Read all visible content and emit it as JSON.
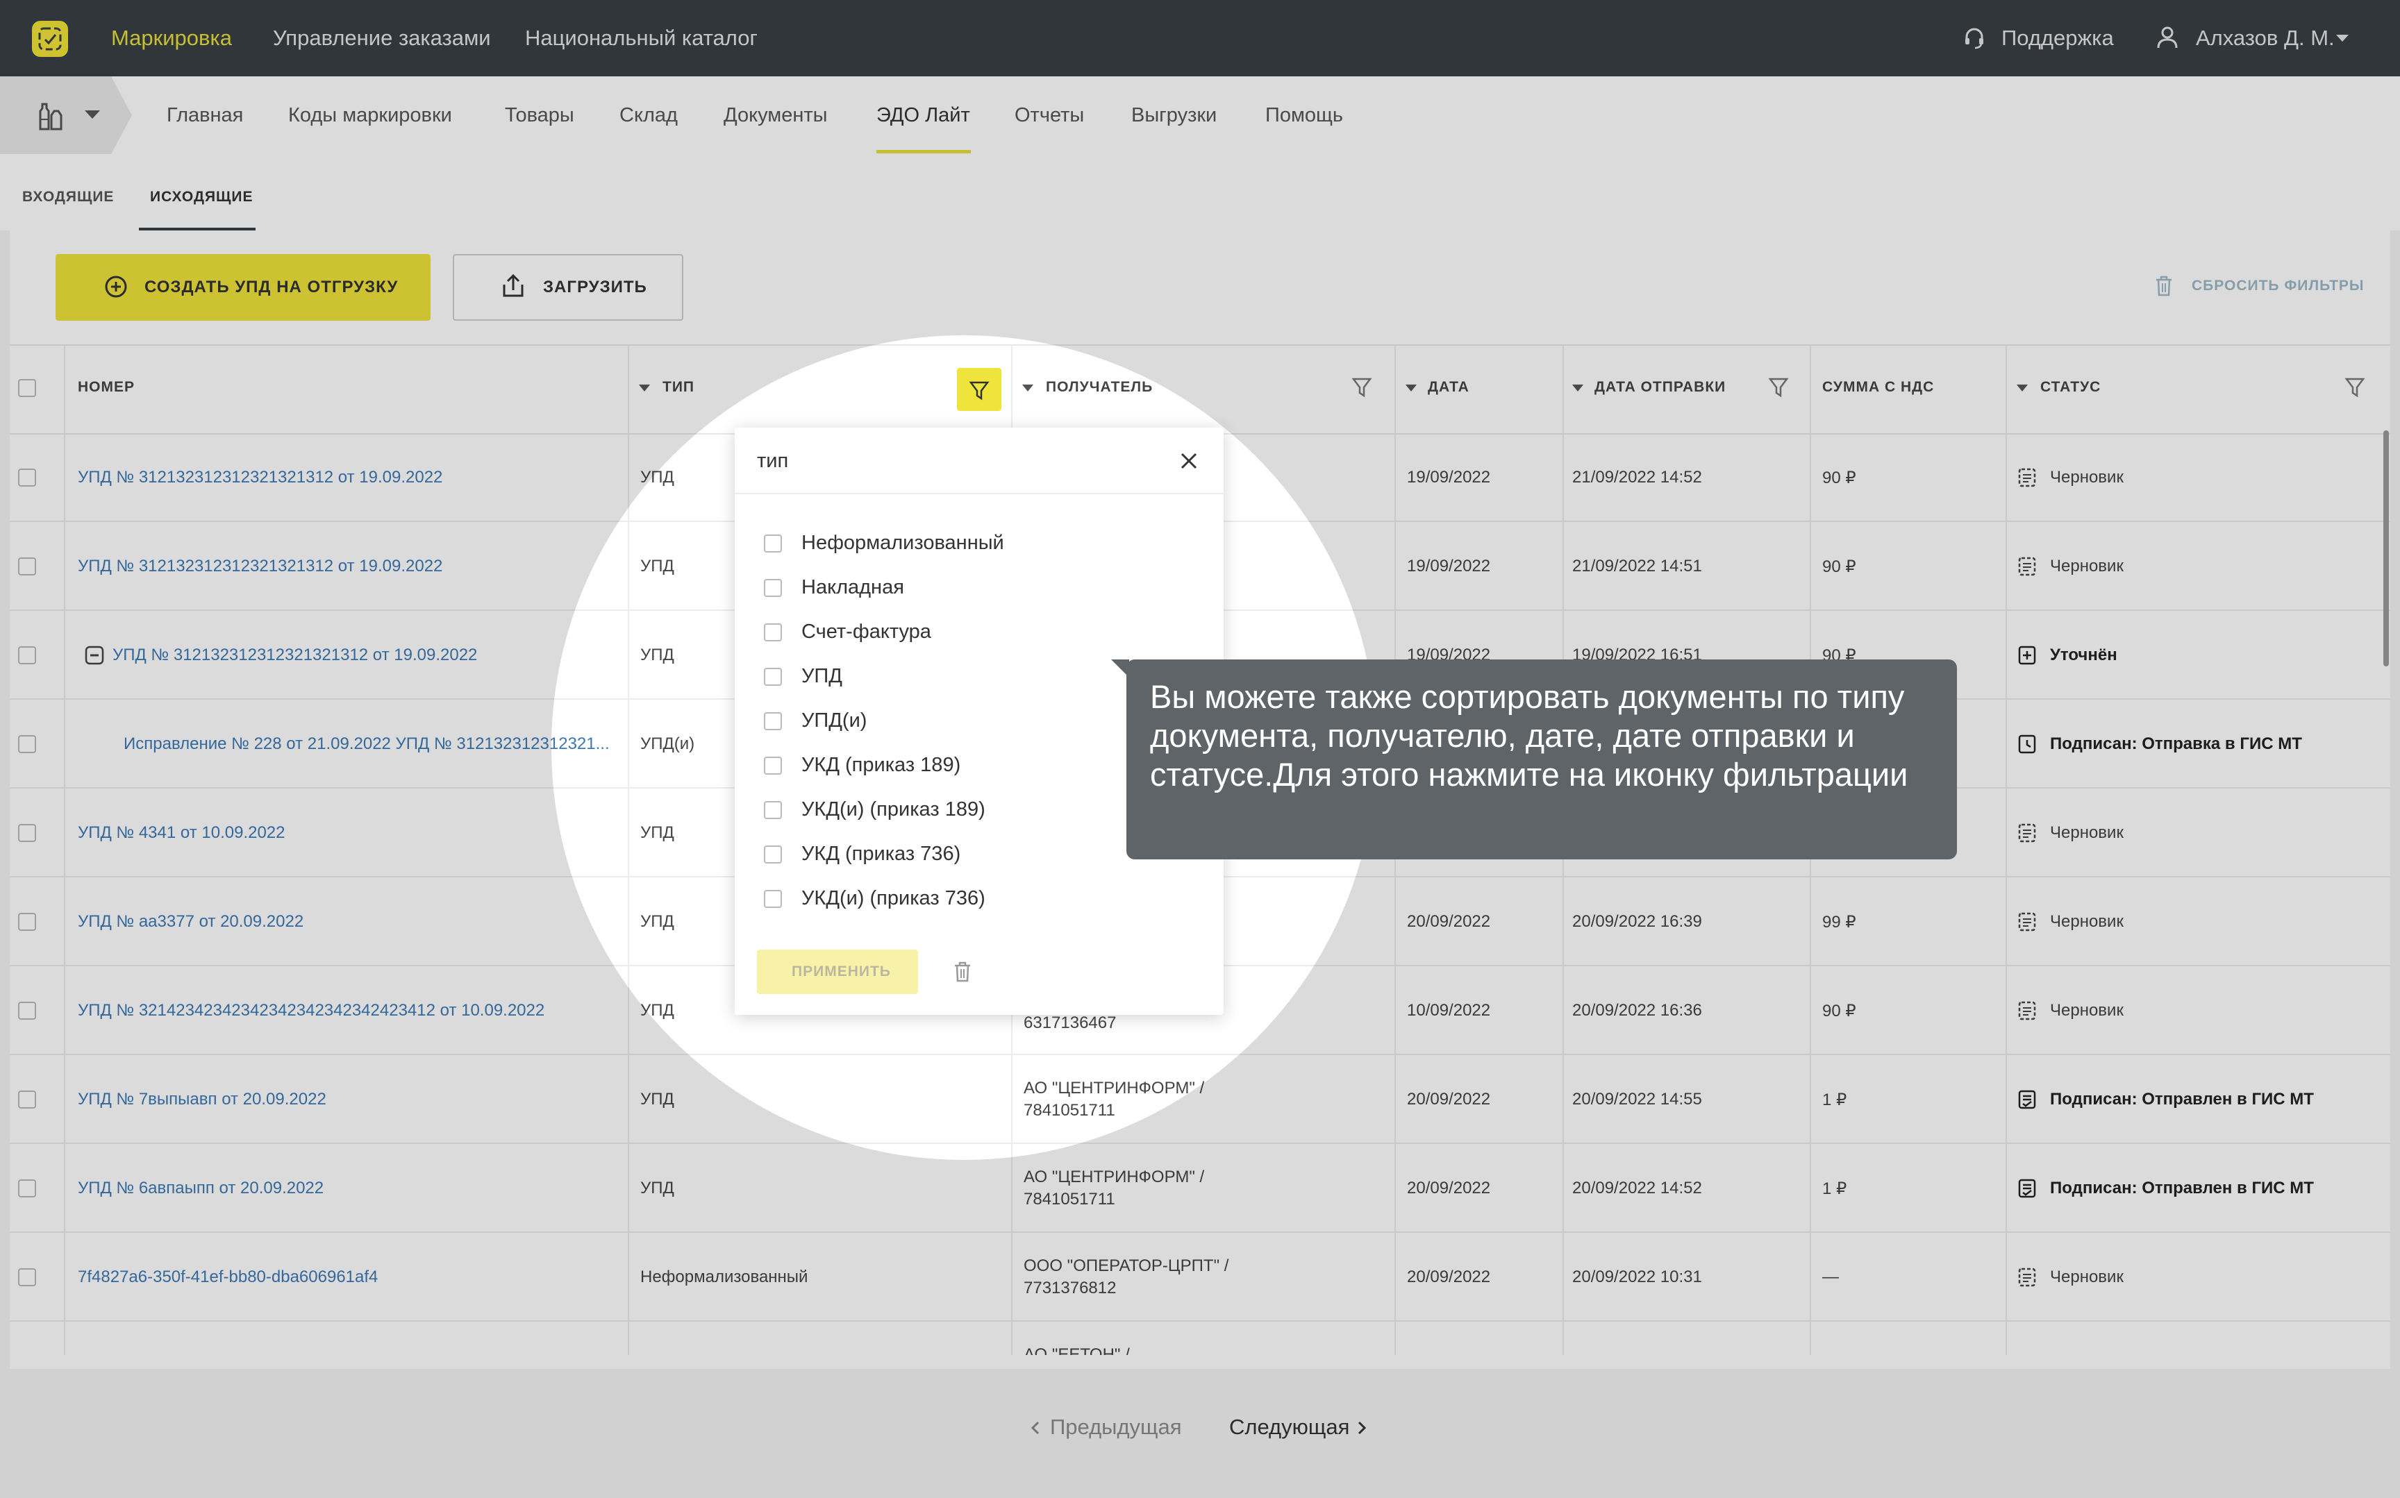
{
  "header": {
    "nav": [
      "Маркировка",
      "Управление заказами",
      "Национальный каталог"
    ],
    "support": "Поддержка",
    "user": "Алхазов Д. М."
  },
  "subnav": {
    "items": [
      "Главная",
      "Коды маркировки",
      "Товары",
      "Склад",
      "Документы",
      "ЭДО Лайт",
      "Отчеты",
      "Выгрузки",
      "Помощь"
    ],
    "active": "ЭДО Лайт"
  },
  "tabs": {
    "incoming": "ВХОДЯЩИЕ",
    "outgoing": "ИСХОДЯЩИЕ",
    "active": "ИСХОДЯЩИЕ"
  },
  "toolbar": {
    "create": "СОЗДАТЬ УПД НА ОТГРУЗКУ",
    "upload": "ЗАГРУЗИТЬ",
    "reset": "СБРОСИТЬ ФИЛЬТРЫ"
  },
  "table": {
    "headers": [
      "НОМЕР",
      "ТИП",
      "ПОЛУЧАТЕЛЬ",
      "ДАТА",
      "ДАТА ОТПРАВКИ",
      "СУММА С НДС",
      "СТАТУС"
    ],
    "rows": [
      {
        "number": "УПД № 312132312312321321312 от 19.09.2022",
        "type": "УПД",
        "recipient": "",
        "recipient2": "",
        "date": "19/09/2022",
        "sent": "21/09/2022 14:52",
        "sum": "90 ₽",
        "status": "Черновик",
        "bold": false
      },
      {
        "number": "УПД № 312132312312321321312 от 19.09.2022",
        "type": "УПД",
        "recipient": "",
        "recipient2": "",
        "date": "19/09/2022",
        "sent": "21/09/2022 14:51",
        "sum": "90 ₽",
        "status": "Черновик",
        "bold": false
      },
      {
        "number": "УПД № 312132312312321321312 от 19.09.2022",
        "type": "УПД",
        "recipient": "",
        "recipient2": "",
        "date": "19/09/2022",
        "sent": "19/09/2022 16:51",
        "sum": "90 ₽",
        "status": "Уточнён",
        "bold": true
      },
      {
        "number": "Исправление № 228 от 21.09.2022 УПД № 312132312312321...",
        "type": "УПД(и)",
        "recipient": "",
        "recipient2": "",
        "date": "",
        "sent": "",
        "sum": "",
        "status": "Подписан: Отправка в ГИС МТ",
        "bold": true
      },
      {
        "number": "УПД № 4341 от 10.09.2022",
        "type": "УПД",
        "recipient": "",
        "recipient2": "",
        "date": "",
        "sent": "",
        "sum": "",
        "status": "Черновик",
        "bold": false
      },
      {
        "number": "УПД № аа3377 от 20.09.2022",
        "type": "УПД",
        "recipient": "",
        "recipient2": "",
        "date": "20/09/2022",
        "sent": "20/09/2022 16:39",
        "sum": "99 ₽",
        "status": "Черновик",
        "bold": false
      },
      {
        "number": "УПД № 32142342342342342342342342423412 от 10.09.2022",
        "type": "УПД",
        "recipient": "",
        "recipient2": "6317136467",
        "date": "10/09/2022",
        "sent": "20/09/2022 16:36",
        "sum": "90 ₽",
        "status": "Черновик",
        "bold": false
      },
      {
        "number": "УПД № 7выпыавп от 20.09.2022",
        "type": "УПД",
        "recipient": "АО \"ЦЕНТРИНФОРМ\" /",
        "recipient2": "7841051711",
        "date": "20/09/2022",
        "sent": "20/09/2022 14:55",
        "sum": "1 ₽",
        "status": "Подписан: Отправлен в ГИС МТ",
        "bold": true
      },
      {
        "number": "УПД № 6авпаыпп от 20.09.2022",
        "type": "УПД",
        "recipient": "АО \"ЦЕНТРИНФОРМ\" /",
        "recipient2": "7841051711",
        "date": "20/09/2022",
        "sent": "20/09/2022 14:52",
        "sum": "1 ₽",
        "status": "Подписан: Отправлен в ГИС МТ",
        "bold": true
      },
      {
        "number": "7f4827a6-350f-41ef-bb80-dba606961af4",
        "type": "Неформализованный",
        "recipient": "ООО \"ОПЕРАТОР-ЦРПТ\" /",
        "recipient2": "7731376812",
        "date": "20/09/2022",
        "sent": "20/09/2022 10:31",
        "sum": "—",
        "status": "Черновик",
        "bold": false
      }
    ],
    "partial_row_recipient": "АО \"ЕЕТОН\" /"
  },
  "pagination": {
    "prev": "Предыдущая",
    "next": "Следующая"
  },
  "filter_popup": {
    "title": "тип",
    "options": [
      "Неформализованный",
      "Накладная",
      "Счет-фактура",
      "УПД",
      "УПД(и)",
      "УКД (приказ 189)",
      "УКД(и) (приказ 189)",
      "УКД (приказ 736)",
      "УКД(и) (приказ 736)"
    ],
    "apply": "ПРИМЕНИТЬ"
  },
  "tooltip": {
    "text": "Вы можете также сортировать документы по типу документа, получателю, дате, дате отправки и статусе.Для этого нажмите на иконку фильтрации"
  },
  "colors": {
    "accent": "#efe43b",
    "topbar": "#3a3f45",
    "link": "#3d78b5",
    "tooltip": "#5f6468"
  }
}
